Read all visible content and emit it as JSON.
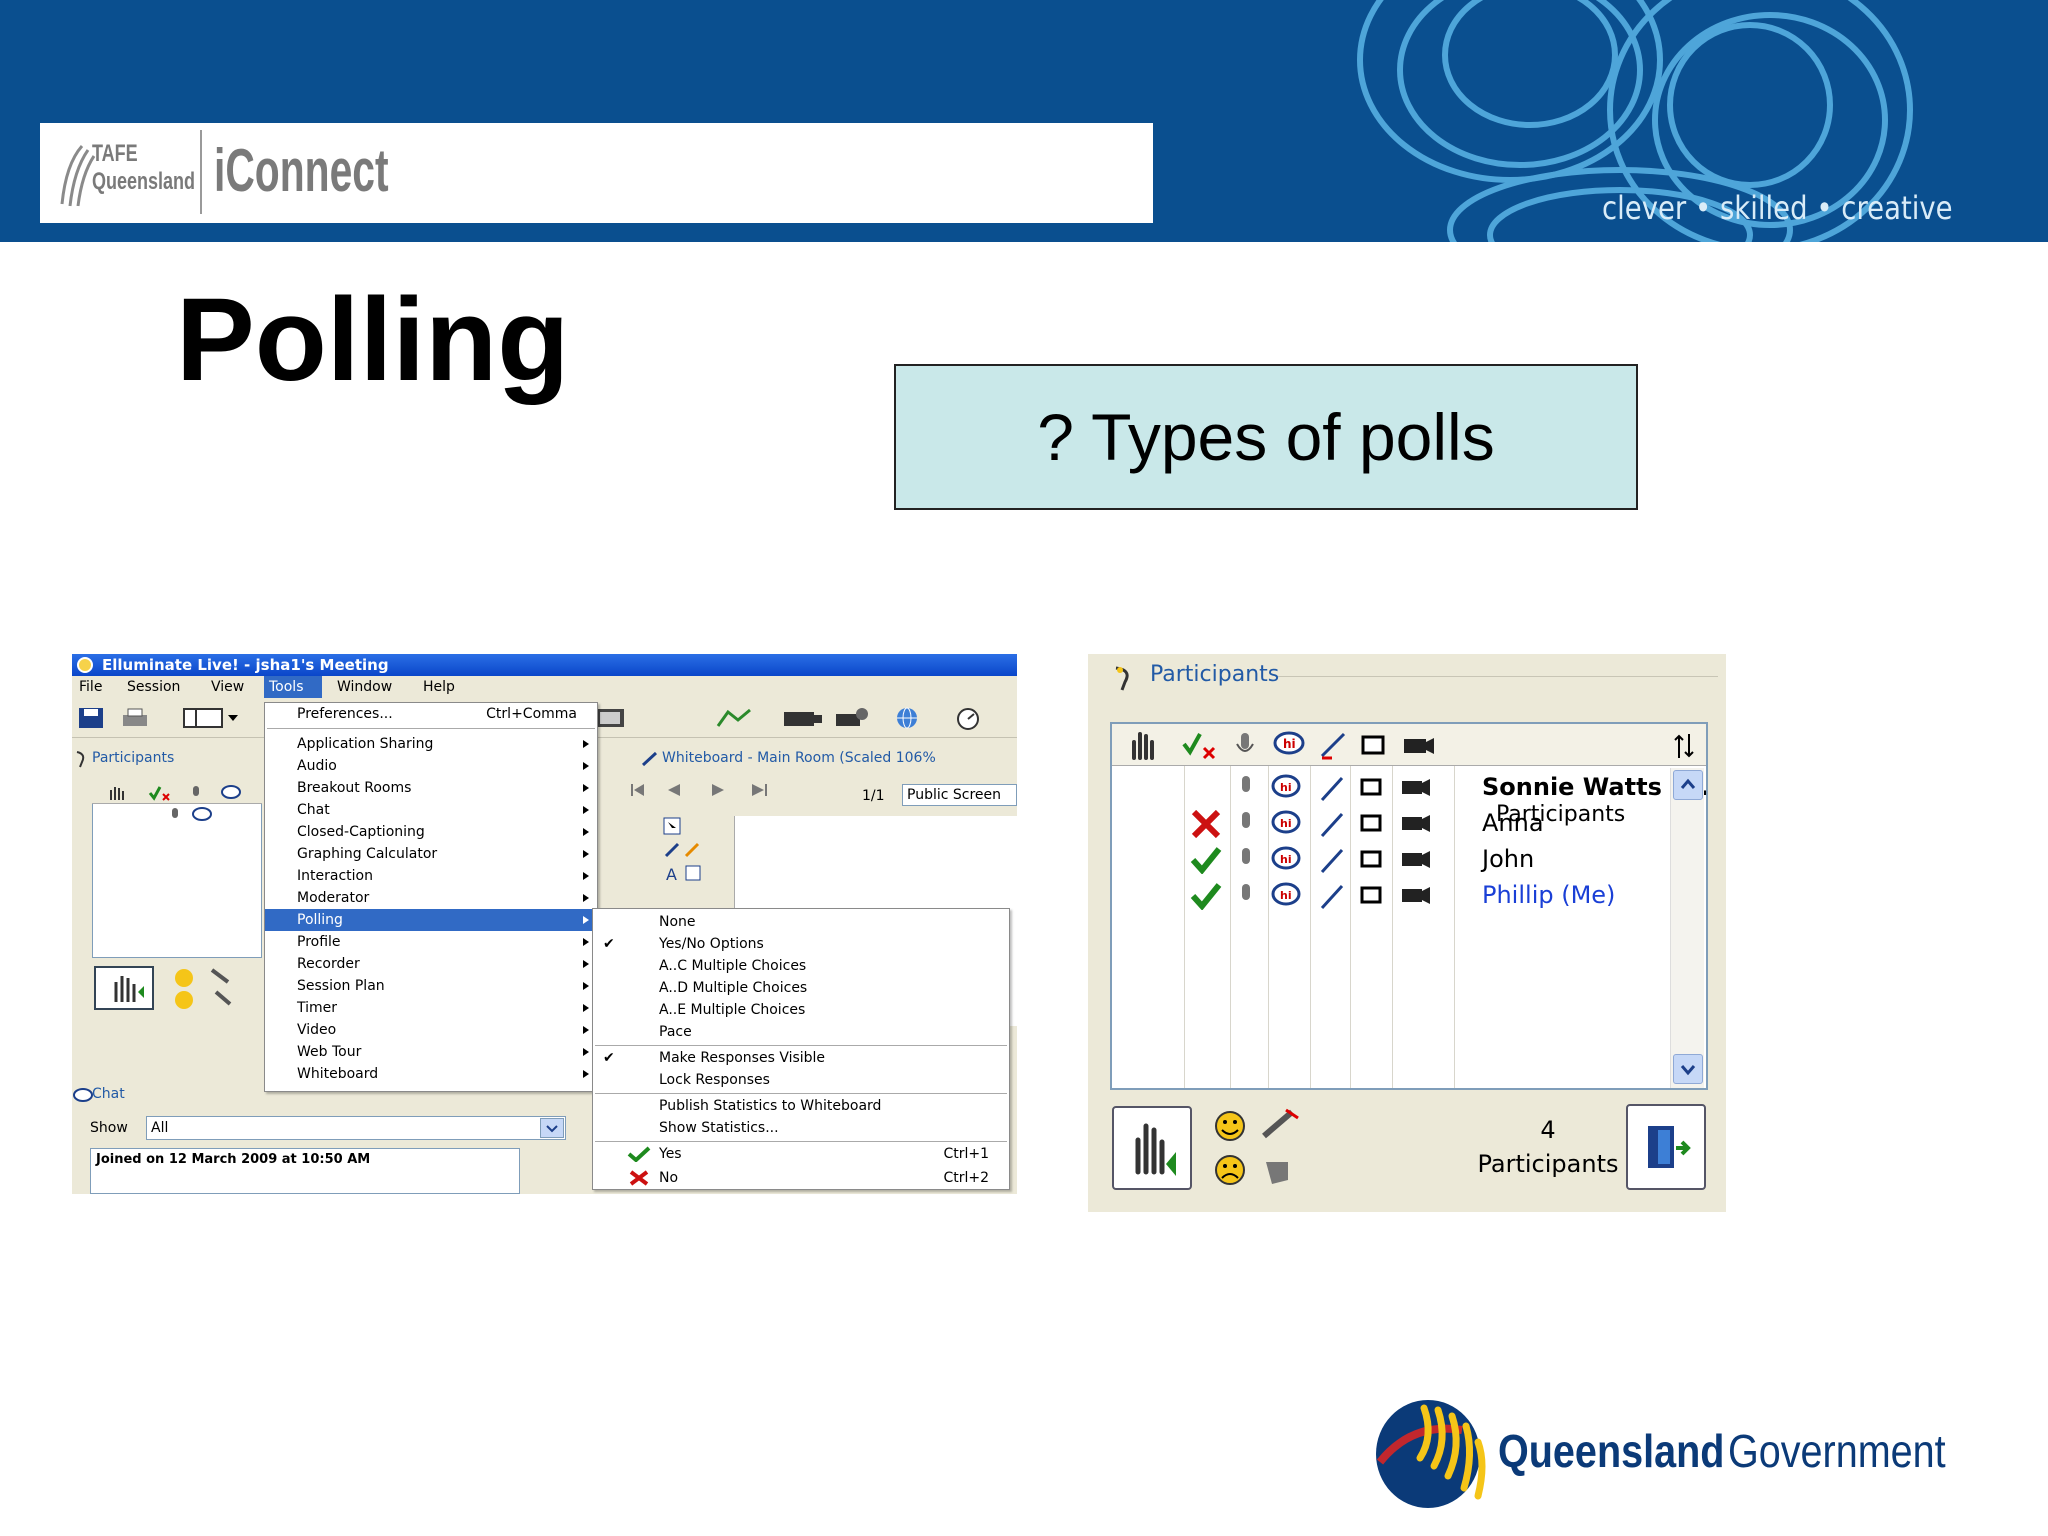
{
  "header": {
    "brand_tafe_line1": "TAFE",
    "brand_tafe_line2": "Queensland",
    "brand_product": "iConnect",
    "tagline": "clever • skilled • creative",
    "colors": {
      "band": "#0a4f8f",
      "swirl": "#5ab4e6"
    }
  },
  "slide": {
    "title": "Polling",
    "callout": "? Types of polls",
    "callout_bg": "#c9e8e9"
  },
  "app": {
    "window_title": "Elluminate Live! - jsha1's Meeting",
    "menubar": [
      "File",
      "Session",
      "View",
      "Tools",
      "Window",
      "Help"
    ],
    "selected_menu": "Tools",
    "participants_label": "Participants",
    "chat_label": "Chat",
    "show_label": "Show",
    "show_value": "All",
    "chat_message": "Joined on 12 March 2009 at 10:50 AM",
    "whiteboard_label": "Whiteboard - Main Room (Scaled 106%",
    "page_count": "1/1",
    "screen_select": "Public Screen",
    "tools_menu": {
      "preferences": {
        "label": "Preferences...",
        "shortcut": "Ctrl+Comma"
      },
      "items": [
        "Application Sharing",
        "Audio",
        "Breakout Rooms",
        "Chat",
        "Closed-Captioning",
        "Graphing Calculator",
        "Interaction",
        "Moderator",
        "Polling",
        "Profile",
        "Recorder",
        "Session Plan",
        "Timer",
        "Video",
        "Web Tour",
        "Whiteboard"
      ],
      "selected": "Polling"
    },
    "polling_menu": {
      "types": [
        "None",
        "Yes/No Options",
        "A..C Multiple Choices",
        "A..D Multiple Choices",
        "A..E Multiple Choices",
        "Pace"
      ],
      "checked_type": "Yes/No Options",
      "visibility": [
        "Make Responses Visible",
        "Lock Responses"
      ],
      "checked_visibility": "Make Responses Visible",
      "statistics": [
        "Publish Statistics to Whiteboard",
        "Show Statistics..."
      ],
      "yes": {
        "label": "Yes",
        "shortcut": "Ctrl+1"
      },
      "no": {
        "label": "No",
        "shortcut": "Ctrl+2"
      }
    }
  },
  "participants_panel": {
    "header": "Participants",
    "column_header": "Participants",
    "rows": [
      {
        "name": "Sonnie Watts (...",
        "response": "none",
        "style": "bold"
      },
      {
        "name": "Anna",
        "response": "no",
        "style": "normal"
      },
      {
        "name": "John",
        "response": "yes",
        "style": "normal"
      },
      {
        "name": "Phillip (Me)",
        "response": "yes",
        "style": "me"
      }
    ],
    "count": "4",
    "count_label": "Participants"
  },
  "footer": {
    "gov_bold": "Queensland",
    "gov_regular": "Government"
  }
}
